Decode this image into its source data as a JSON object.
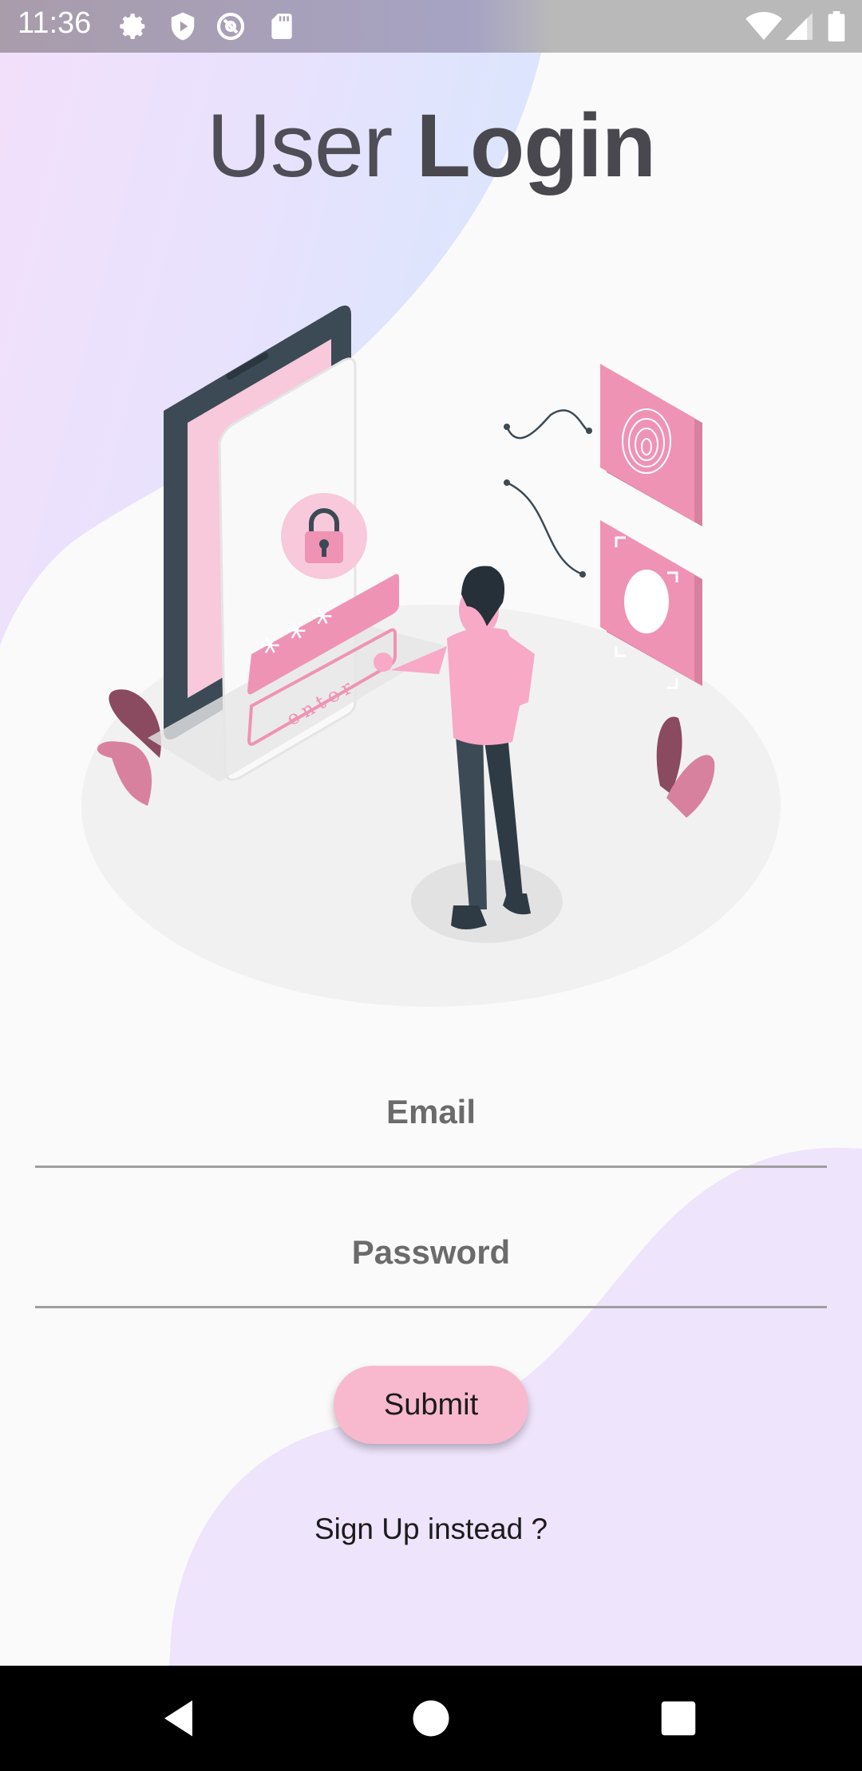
{
  "status_bar": {
    "time": "11:36",
    "left_icons": [
      "gear-icon",
      "shield-play-icon",
      "at-sign-icon",
      "sd-card-icon"
    ],
    "right_icons": [
      "wifi-icon",
      "signal-icon",
      "battery-icon"
    ]
  },
  "title": {
    "part1": "User",
    "part2": "Login"
  },
  "illustration": {
    "screen_text": "enter",
    "password_mask": "* * *"
  },
  "form": {
    "email_placeholder": "Email",
    "password_placeholder": "Password",
    "submit_label": "Submit",
    "signup_link": "Sign Up instead ?"
  },
  "navigation_bar": [
    "back-icon",
    "home-icon",
    "recents-icon"
  ],
  "colors": {
    "accent_pink": "#f8b9cf",
    "illustration_pink": "#ef93b4",
    "blob_lavender": "#eee4fb",
    "dark_slate": "#3c4a55"
  }
}
